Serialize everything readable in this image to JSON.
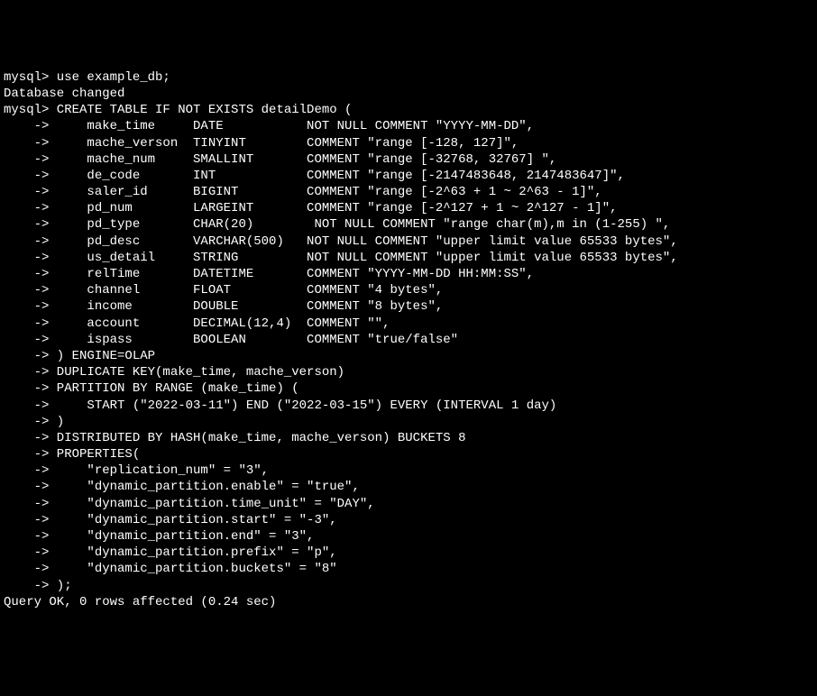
{
  "lines": [
    "mysql> use example_db;",
    "Database changed",
    "mysql> CREATE TABLE IF NOT EXISTS detailDemo (",
    "    ->     make_time     DATE           NOT NULL COMMENT \"YYYY-MM-DD\",",
    "    ->     mache_verson  TINYINT        COMMENT \"range [-128, 127]\",",
    "    ->     mache_num     SMALLINT       COMMENT \"range [-32768, 32767] \",",
    "    ->     de_code       INT            COMMENT \"range [-2147483648, 2147483647]\",",
    "    ->     saler_id      BIGINT         COMMENT \"range [-2^63 + 1 ~ 2^63 - 1]\",",
    "    ->     pd_num        LARGEINT       COMMENT \"range [-2^127 + 1 ~ 2^127 - 1]\",",
    "    ->     pd_type       CHAR(20)        NOT NULL COMMENT \"range char(m),m in (1-255) \",",
    "    ->     pd_desc       VARCHAR(500)   NOT NULL COMMENT \"upper limit value 65533 bytes\",",
    "    ->     us_detail     STRING         NOT NULL COMMENT \"upper limit value 65533 bytes\",",
    "    ->     relTime       DATETIME       COMMENT \"YYYY-MM-DD HH:MM:SS\",",
    "    ->     channel       FLOAT          COMMENT \"4 bytes\",",
    "    ->     income        DOUBLE         COMMENT \"8 bytes\",",
    "    ->     account       DECIMAL(12,4)  COMMENT \"\",",
    "    ->     ispass        BOOLEAN        COMMENT \"true/false\"",
    "    -> ) ENGINE=OLAP",
    "    -> DUPLICATE KEY(make_time, mache_verson)",
    "    -> PARTITION BY RANGE (make_time) (",
    "    ->     START (\"2022-03-11\") END (\"2022-03-15\") EVERY (INTERVAL 1 day)",
    "    -> )",
    "    -> DISTRIBUTED BY HASH(make_time, mache_verson) BUCKETS 8",
    "    -> PROPERTIES(",
    "    ->     \"replication_num\" = \"3\",",
    "    ->     \"dynamic_partition.enable\" = \"true\",",
    "    ->     \"dynamic_partition.time_unit\" = \"DAY\",",
    "    ->     \"dynamic_partition.start\" = \"-3\",",
    "    ->     \"dynamic_partition.end\" = \"3\",",
    "    ->     \"dynamic_partition.prefix\" = \"p\",",
    "    ->     \"dynamic_partition.buckets\" = \"8\"",
    "    -> );",
    "Query OK, 0 rows affected (0.24 sec)"
  ]
}
